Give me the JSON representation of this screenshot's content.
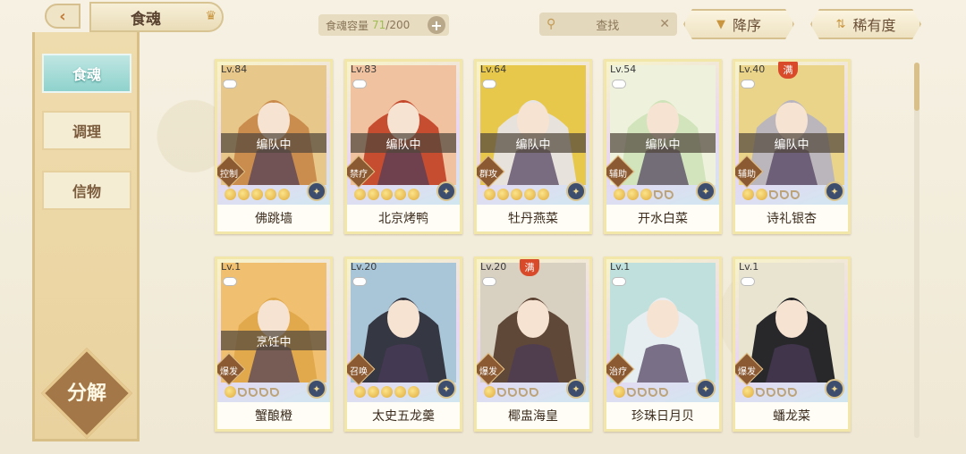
{
  "header": {
    "back_icon": "‹",
    "title": "食魂",
    "capacity_label": "食魂容量",
    "capacity_current": "71",
    "capacity_total": "/200",
    "add_icon": "+",
    "search_placeholder": "查找",
    "clear_icon": "✕",
    "sort_desc_label": "降序",
    "sort_rarity_label": "稀有度"
  },
  "sidebar": {
    "tabs": [
      {
        "label": "食魂",
        "active": true
      },
      {
        "label": "调理",
        "active": false
      },
      {
        "label": "信物",
        "active": false
      }
    ],
    "decompose_label": "分解"
  },
  "cards": [
    {
      "level": "Lv.84",
      "status": "编队中",
      "role": "控制",
      "stars": 5,
      "name": "佛跳墙",
      "full": false,
      "hair": "#c98a4a",
      "bg": "#e8c88a"
    },
    {
      "level": "Lv.83",
      "status": "编队中",
      "role": "禁疗",
      "stars": 5,
      "name": "北京烤鸭",
      "full": false,
      "hair": "#c4472a",
      "bg": "#f0c2a0"
    },
    {
      "level": "Lv.64",
      "status": "编队中",
      "role": "群攻",
      "stars": 5,
      "name": "牡丹燕菜",
      "full": false,
      "hair": "#e8e4e4",
      "bg": "#e8c84a"
    },
    {
      "level": "Lv.54",
      "status": "编队中",
      "role": "辅助",
      "stars": 3,
      "name": "开水白菜",
      "full": false,
      "hair": "#cfe3b8",
      "bg": "#eef2dc"
    },
    {
      "level": "Lv.40",
      "status": "编队中",
      "role": "辅助",
      "stars": 2,
      "name": "诗礼银杏",
      "full": true,
      "hair": "#b8b4bf",
      "bg": "#e9d48a"
    },
    {
      "level": "Lv.1",
      "status": "烹饪中",
      "role": "爆发",
      "stars": 1,
      "name": "蟹酿橙",
      "full": false,
      "hair": "#e0a84a",
      "bg": "#f0c070"
    },
    {
      "level": "Lv.20",
      "status": "",
      "role": "召唤",
      "stars": 5,
      "name": "太史五龙羹",
      "full": false,
      "hair": "#2e2f3a",
      "bg": "#a9c6d8"
    },
    {
      "level": "Lv.20",
      "status": "",
      "role": "爆发",
      "stars": 1,
      "name": "椰盅海皇",
      "full": true,
      "hair": "#5a4030",
      "bg": "#d8d0c0"
    },
    {
      "level": "Lv.1",
      "status": "",
      "role": "治疗",
      "stars": 1,
      "name": "珍珠日月贝",
      "full": false,
      "hair": "#e8eef2",
      "bg": "#bfe0dc"
    },
    {
      "level": "Lv.1",
      "status": "",
      "role": "爆发",
      "stars": 1,
      "name": "蟠龙菜",
      "full": false,
      "hair": "#1e1e22",
      "bg": "#e8e4d0"
    }
  ],
  "colors": {
    "accent": "#c9963f",
    "active_tab": "#8fd2cd",
    "capacity_num": "#9fbd52",
    "full_badge": "#d84a2a"
  },
  "icons": {
    "search": "search-icon",
    "sort": "triangle-down-icon",
    "rarity": "sort-arrows-icon",
    "crown": "crown-icon"
  }
}
